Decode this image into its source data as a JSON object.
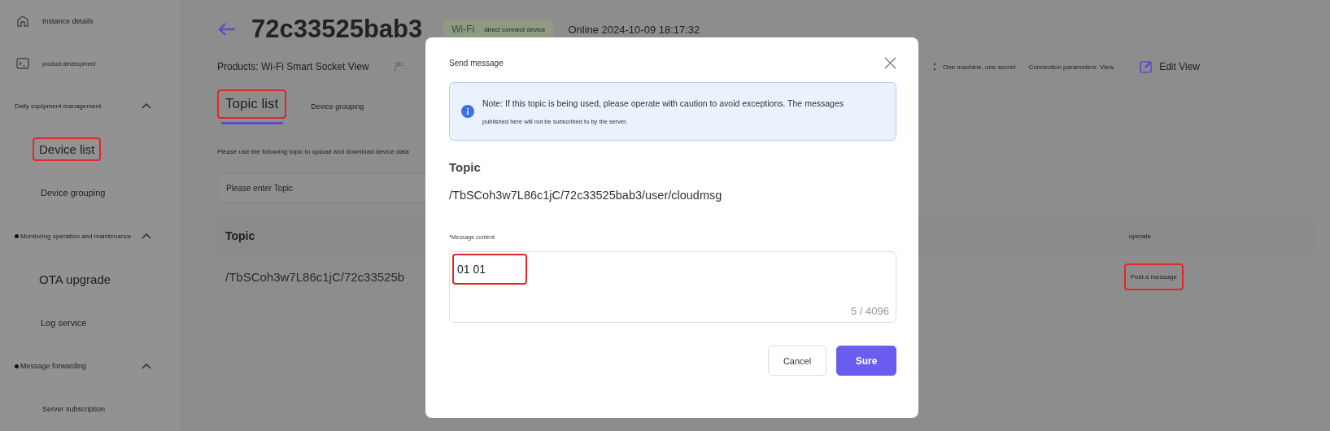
{
  "sidebar": {
    "items": [
      {
        "label": "Instance details",
        "kind": "nav",
        "highlighted": false
      },
      {
        "label": "product development",
        "kind": "nav",
        "highlighted": false
      },
      {
        "label": "Daily equipment management",
        "kind": "group",
        "expanded": true,
        "bullet": false,
        "highlighted": false
      },
      {
        "label": "Device list",
        "kind": "sub",
        "highlighted": true
      },
      {
        "label": "Device grouping",
        "kind": "sub",
        "highlighted": false
      },
      {
        "label": "Monitoring operation and maintenance",
        "kind": "group",
        "expanded": true,
        "bullet": true,
        "highlighted": false
      },
      {
        "label": "OTA upgrade",
        "kind": "sub",
        "highlighted": false
      },
      {
        "label": "Log service",
        "kind": "sub",
        "highlighted": false
      },
      {
        "label": "Message forwarding",
        "kind": "group",
        "expanded": true,
        "bullet": true,
        "highlighted": false
      },
      {
        "label": "Server subscription",
        "kind": "sub",
        "highlighted": false
      }
    ]
  },
  "header": {
    "title": "72c33525bab3",
    "badges": [
      "Wi-Fi",
      "direct connect device"
    ],
    "status": "Online 2024-10-09 18:17:32",
    "product": "Products: Wi-Fi Smart Socket View",
    "product_cut": "产",
    "auth": "One machine, one secret",
    "connection": "Connection parameters: View",
    "edit": "Edit View"
  },
  "tabs": [
    {
      "label": "Topic list",
      "selected": true,
      "highlighted": true
    },
    {
      "label": "Device grouping",
      "selected": false,
      "highlighted": false
    }
  ],
  "hint": "Please use the following topic to upload and download device data",
  "search": {
    "placeholder": "Please enter Topic"
  },
  "table": {
    "columns": [
      "Topic",
      "operate"
    ],
    "rows": [
      {
        "topic": "/TbSCoh3w7L86c1jC/72c33525b",
        "action": "Post a message",
        "highlighted": true
      }
    ]
  },
  "dialog": {
    "title": "Send message",
    "note": "Note: If this topic is being used, please operate with caution to avoid exceptions. The messages",
    "note_2": "published here will not be subscribed to by the server.",
    "topic_label": "Topic",
    "topic": "/TbSCoh3w7L86c1jC/72c33525bab3/user/cloudmsg",
    "content_label": "*Message content",
    "content": "01 01",
    "content_highlighted": true,
    "counter": "5 / 4096",
    "buttons": [
      {
        "label": "Cancel",
        "kind": "secondary"
      },
      {
        "label": "Sure",
        "kind": "primary"
      }
    ]
  }
}
